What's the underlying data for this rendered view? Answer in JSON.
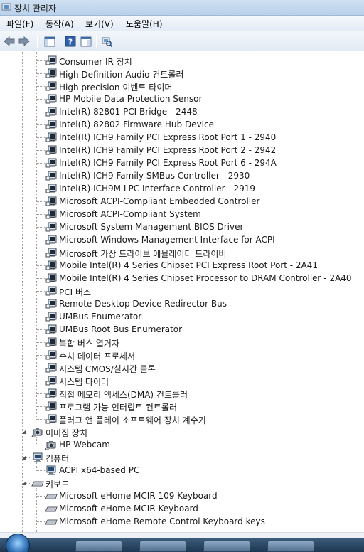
{
  "window": {
    "title": "장치 관리자"
  },
  "menu": [
    {
      "label": "파일(F)"
    },
    {
      "label": "동작(A)"
    },
    {
      "label": "보기(V)"
    },
    {
      "label": "도움말(H)"
    }
  ],
  "toolbar": {
    "buttons": [
      {
        "name": "back-button",
        "icon": "arrow-left-icon"
      },
      {
        "name": "forward-button",
        "icon": "arrow-right-icon"
      },
      {
        "name": "show-hide-tree-button",
        "icon": "console-tree-icon"
      },
      {
        "name": "help-button",
        "icon": "help-icon"
      },
      {
        "name": "properties-button",
        "icon": "properties-icon"
      },
      {
        "name": "scan-hardware-button",
        "icon": "scan-hardware-icon"
      }
    ]
  },
  "tree": {
    "rows": [
      {
        "label": "Consumer IR 장치",
        "level": 2,
        "icon": "system-device-icon"
      },
      {
        "label": "High Definition Audio 컨트롤러",
        "level": 2,
        "icon": "system-device-icon"
      },
      {
        "label": "High precision 이벤트 타이머",
        "level": 2,
        "icon": "system-device-icon"
      },
      {
        "label": "HP Mobile Data Protection Sensor",
        "level": 2,
        "icon": "system-device-icon"
      },
      {
        "label": "Intel(R) 82801 PCI Bridge - 2448",
        "level": 2,
        "icon": "system-device-icon"
      },
      {
        "label": "Intel(R) 82802 Firmware Hub Device",
        "level": 2,
        "icon": "system-device-icon"
      },
      {
        "label": "Intel(R) ICH9 Family PCI Express Root Port 1 - 2940",
        "level": 2,
        "icon": "system-device-icon"
      },
      {
        "label": "Intel(R) ICH9 Family PCI Express Root Port 2 - 2942",
        "level": 2,
        "icon": "system-device-icon"
      },
      {
        "label": "Intel(R) ICH9 Family PCI Express Root Port 6 - 294A",
        "level": 2,
        "icon": "system-device-icon"
      },
      {
        "label": "Intel(R) ICH9 Family SMBus Controller - 2930",
        "level": 2,
        "icon": "system-device-icon"
      },
      {
        "label": "Intel(R) ICH9M LPC Interface Controller - 2919",
        "level": 2,
        "icon": "system-device-icon"
      },
      {
        "label": "Microsoft ACPI-Compliant Embedded Controller",
        "level": 2,
        "icon": "system-device-icon"
      },
      {
        "label": "Microsoft ACPI-Compliant System",
        "level": 2,
        "icon": "system-device-icon"
      },
      {
        "label": "Microsoft System Management BIOS Driver",
        "level": 2,
        "icon": "system-device-icon"
      },
      {
        "label": "Microsoft Windows Management Interface for ACPI",
        "level": 2,
        "icon": "system-device-icon"
      },
      {
        "label": "Microsoft 가상 드라이브 에뮬레이터 드라이버",
        "level": 2,
        "icon": "system-device-icon"
      },
      {
        "label": "Mobile Intel(R) 4 Series Chipset PCI Express Root Port - 2A41",
        "level": 2,
        "icon": "system-device-icon"
      },
      {
        "label": "Mobile Intel(R) 4 Series Chipset Processor to DRAM Controller - 2A40",
        "level": 2,
        "icon": "system-device-icon"
      },
      {
        "label": "PCI 버스",
        "level": 2,
        "icon": "system-device-icon"
      },
      {
        "label": "Remote Desktop Device Redirector Bus",
        "level": 2,
        "icon": "system-device-icon"
      },
      {
        "label": "UMBus Enumerator",
        "level": 2,
        "icon": "system-device-icon"
      },
      {
        "label": "UMBus Root Bus Enumerator",
        "level": 2,
        "icon": "system-device-icon"
      },
      {
        "label": "복합 버스 열거자",
        "level": 2,
        "icon": "system-device-icon"
      },
      {
        "label": "수치 데이터 프로세서",
        "level": 2,
        "icon": "system-device-icon"
      },
      {
        "label": "시스템 CMOS/실시간 클록",
        "level": 2,
        "icon": "system-device-icon"
      },
      {
        "label": "시스템 타이머",
        "level": 2,
        "icon": "system-device-icon"
      },
      {
        "label": "직접 메모리 액세스(DMA) 컨트롤러",
        "level": 2,
        "icon": "system-device-icon"
      },
      {
        "label": "프로그램 가능 인터럽트 컨트롤러",
        "level": 2,
        "icon": "system-device-icon"
      },
      {
        "label": "플러그 앤 플레이 소프트웨어 장치 계수기",
        "level": 2,
        "icon": "system-device-icon"
      },
      {
        "label": "이미징 장치",
        "level": 1,
        "icon": "camera-icon",
        "expanded": true
      },
      {
        "label": "HP Webcam",
        "level": 2,
        "icon": "camera-icon"
      },
      {
        "label": "컴퓨터",
        "level": 1,
        "icon": "computer-icon",
        "expanded": true
      },
      {
        "label": "ACPI x64-based PC",
        "level": 2,
        "icon": "computer-icon"
      },
      {
        "label": "키보드",
        "level": 1,
        "icon": "keyboard-icon",
        "expanded": true
      },
      {
        "label": "Microsoft eHome MCIR 109 Keyboard",
        "level": 2,
        "icon": "keyboard-icon"
      },
      {
        "label": "Microsoft eHome MCIR Keyboard",
        "level": 2,
        "icon": "keyboard-icon"
      },
      {
        "label": "Microsoft eHome Remote Control Keyboard keys",
        "level": 2,
        "icon": "keyboard-icon"
      }
    ]
  }
}
